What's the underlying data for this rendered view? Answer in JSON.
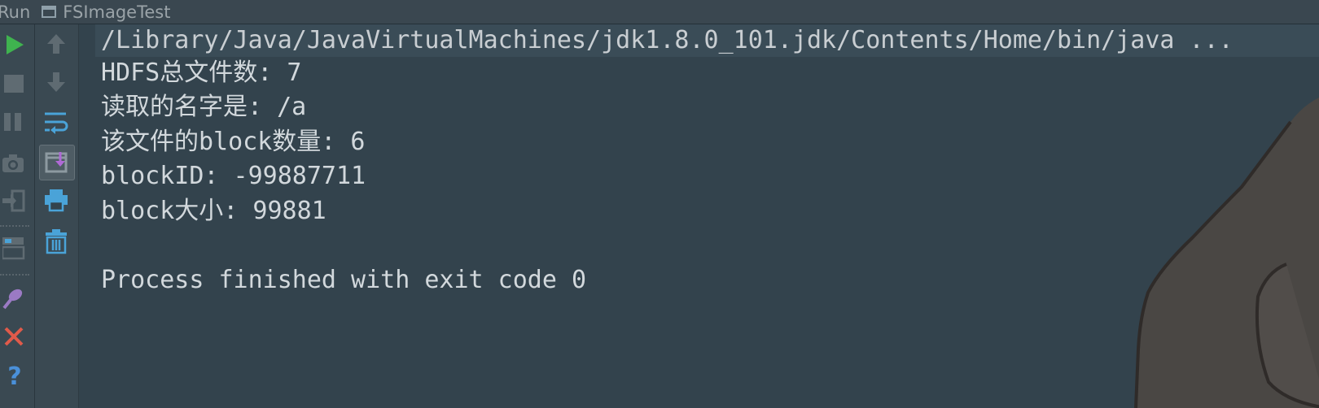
{
  "titlebar": {
    "run_label": "Run",
    "tab_title": "FSImageTest"
  },
  "console": {
    "lines": [
      "/Library/Java/JavaVirtualMachines/jdk1.8.0_101.jdk/Contents/Home/bin/java ...",
      "HDFS总文件数: 7",
      "读取的名字是: /a",
      "该文件的block数量: 6",
      "blockID: -99887711",
      "block大小: 99881",
      "",
      "Process finished with exit code 0"
    ]
  },
  "colors": {
    "background": "#33434d",
    "text": "#d2d8dc",
    "run_green": "#3fb34f",
    "close_red": "#e05a4a",
    "help_blue": "#4a90d9",
    "icon_blue": "#4aa3d8"
  },
  "icons": {
    "outer_toolbar": [
      "run-icon",
      "stop-icon",
      "pause-icon",
      "camera-icon",
      "login-icon",
      "layout-icon",
      "pin-icon",
      "close-icon",
      "help-icon"
    ],
    "inner_toolbar": [
      "up-arrow-icon",
      "down-arrow-icon",
      "soft-wrap-icon",
      "scroll-to-end-icon",
      "print-icon",
      "trash-icon"
    ]
  }
}
